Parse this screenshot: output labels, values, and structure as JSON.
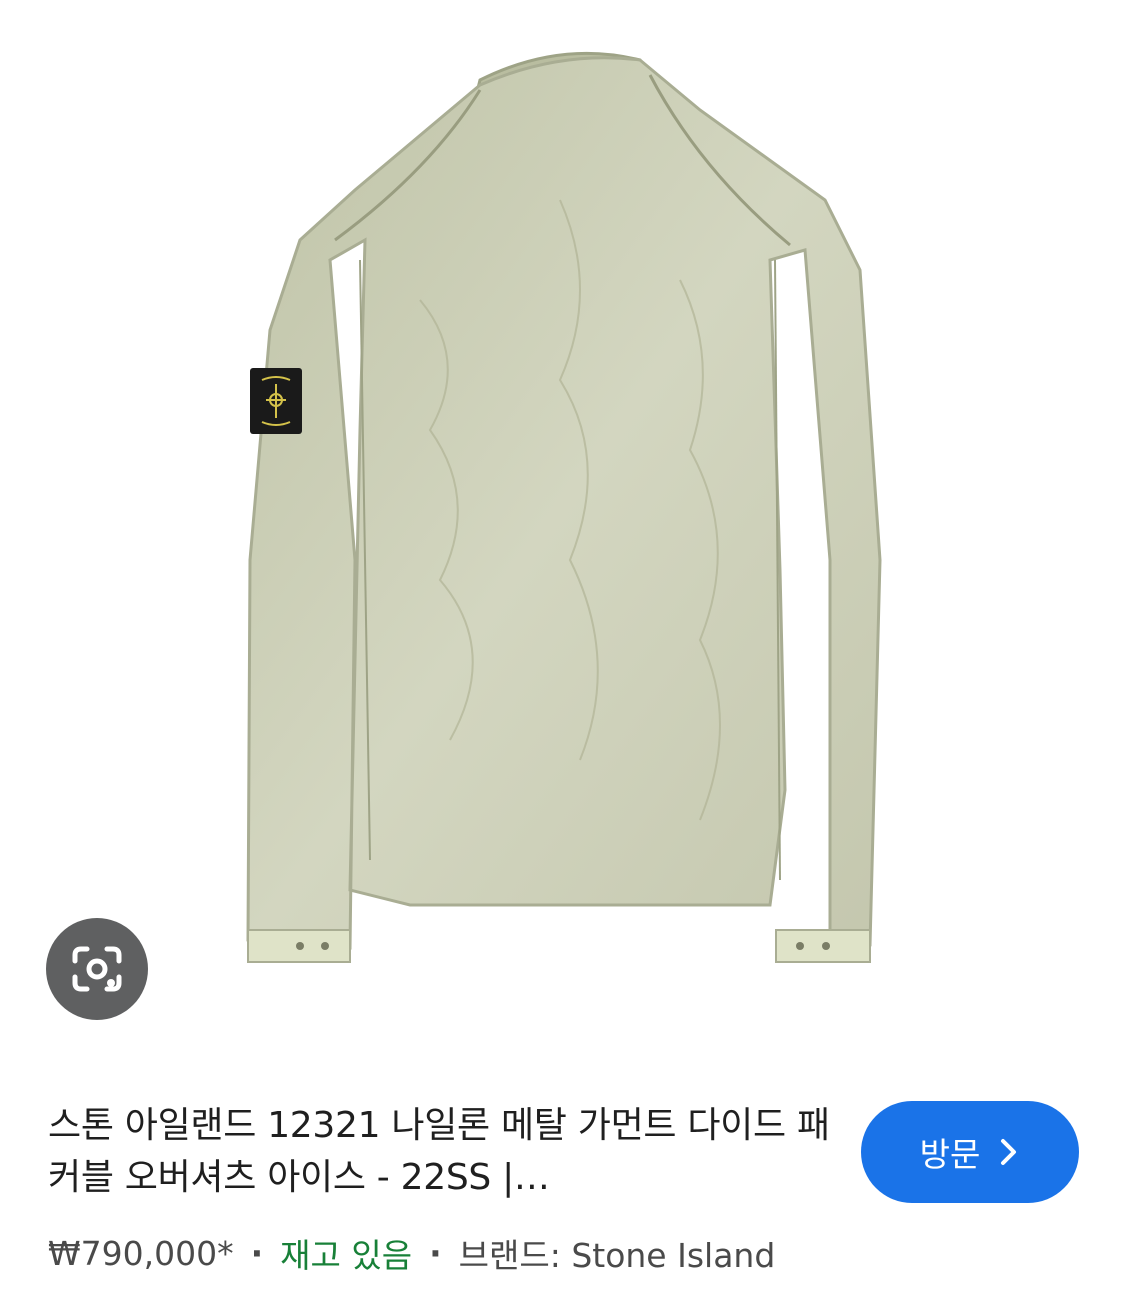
{
  "product": {
    "title": "스톤 아일랜드 12321 나일론 메탈 가먼트 다이드 패커블 오버셔츠 아이스 - 22SS |…",
    "price": "₩790,000*",
    "separator": "·",
    "stock": "재고 있음",
    "brand": "브랜드: Stone Island",
    "image_alt": "Stone Island nylon metal overshirt, back view, ice color"
  },
  "actions": {
    "visit_label": "방문",
    "visit_icon": "chevron-right-icon",
    "lens_icon": "google-lens-icon"
  },
  "colors": {
    "visit_button": "#1a73e8",
    "stock_text": "#188038",
    "lens_button": "#5f6061",
    "jacket": "#c8cbb2"
  }
}
